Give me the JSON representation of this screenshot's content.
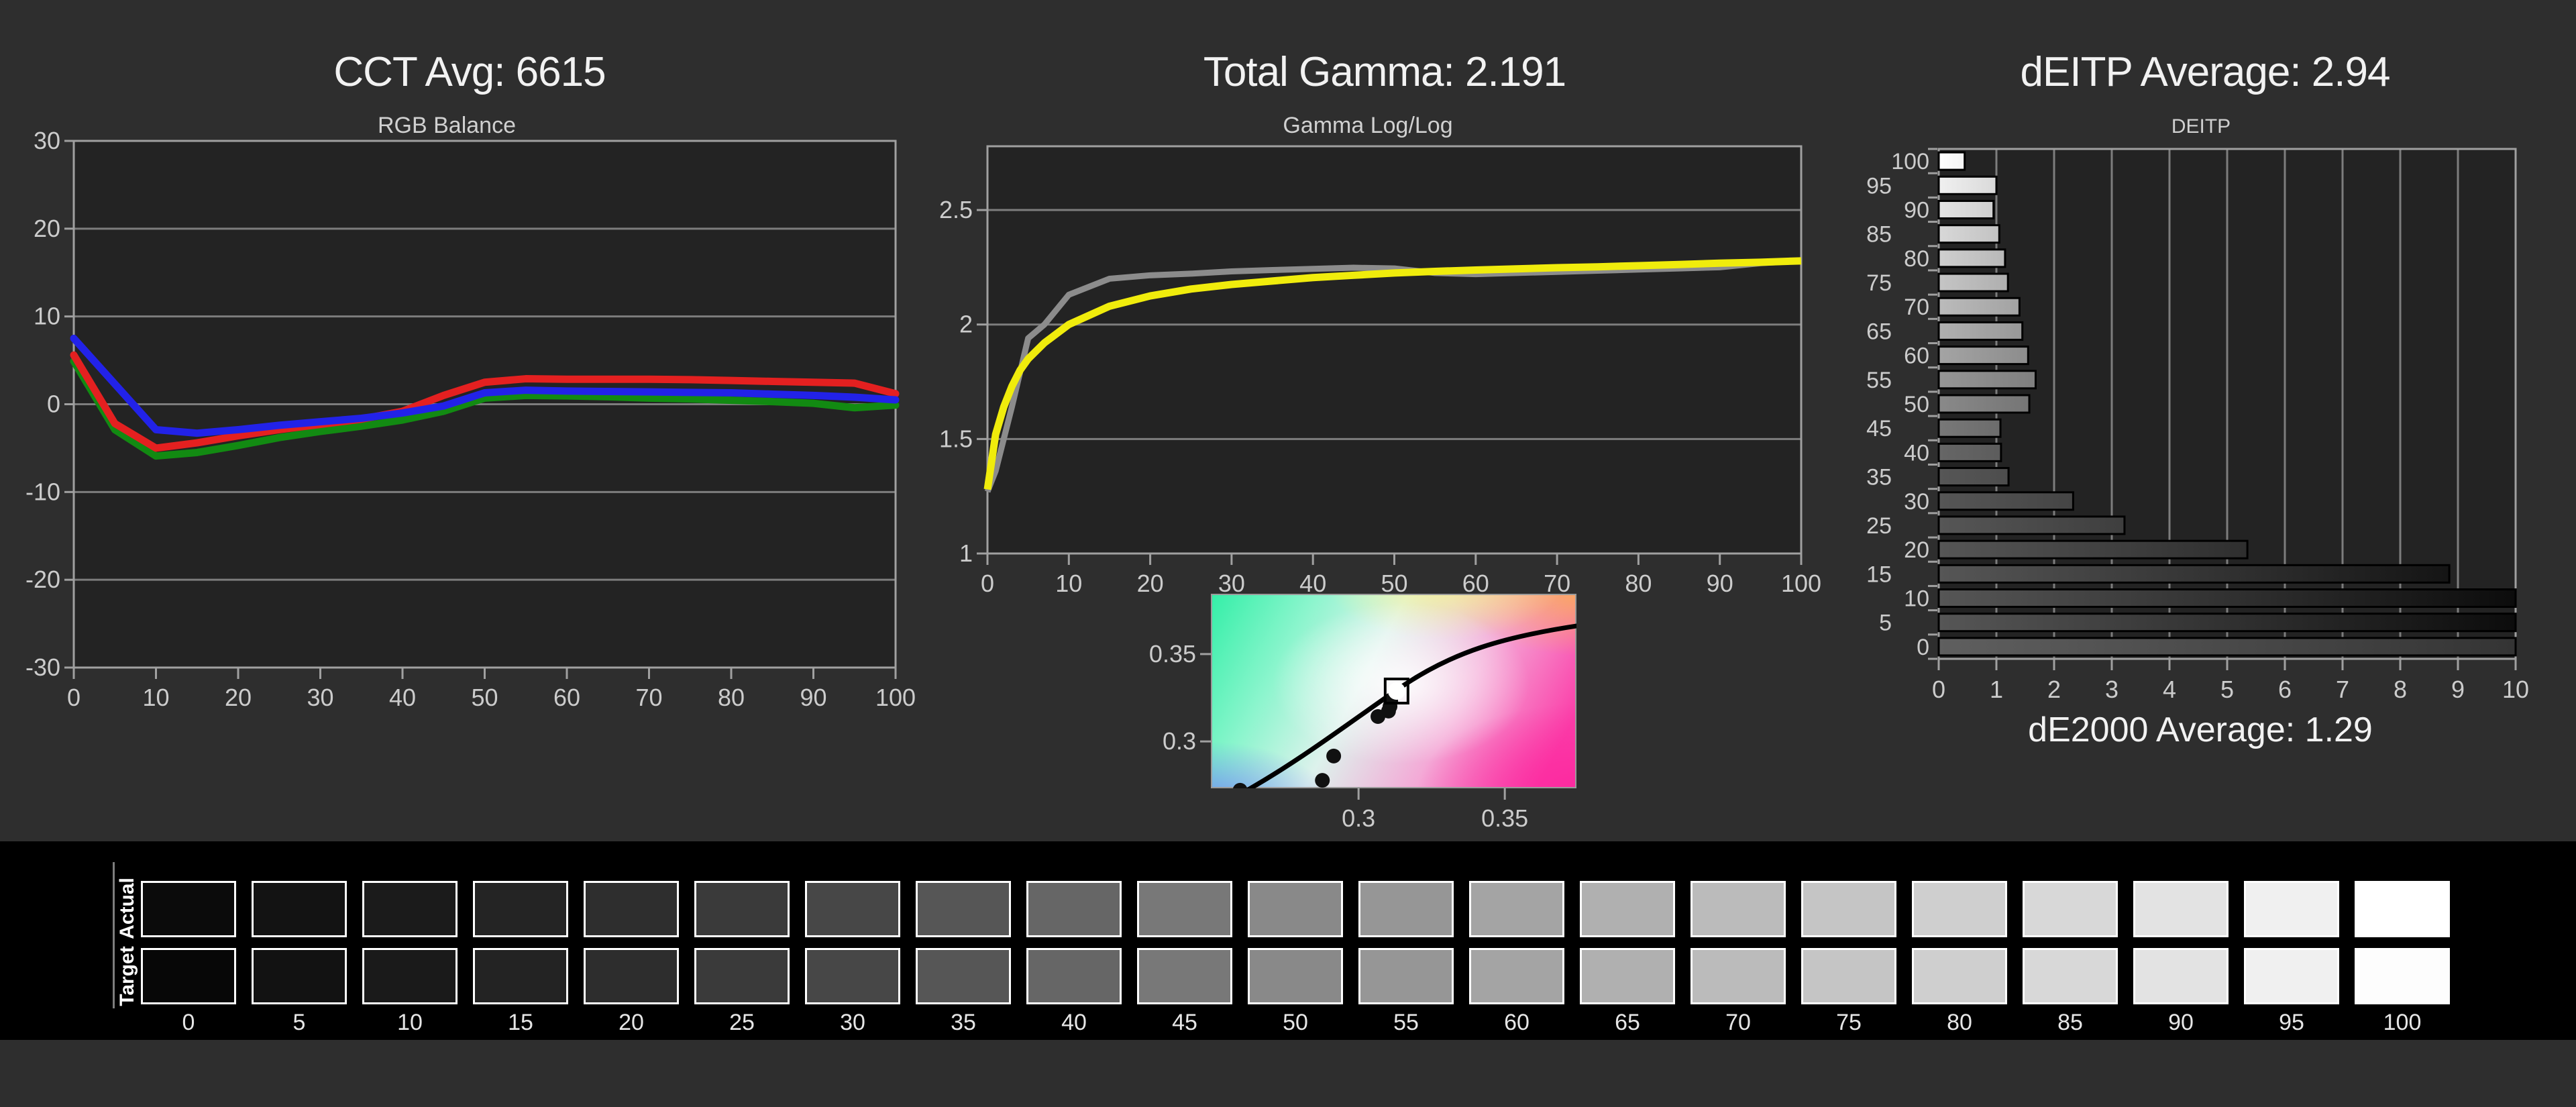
{
  "colors": {
    "page_bg": "#2e2e2e",
    "plot_bg": "#232323",
    "grid": "#7d7d7d",
    "border": "#a0a0a0",
    "tick_text": "#cccccc",
    "title_text": "#f2f2f2",
    "strip_bg": "#000000",
    "red": "#e42020",
    "green": "#128a12",
    "blue": "#2222e8",
    "yellow": "#f0ec0c",
    "gray_line": "#8c8c8c"
  },
  "chart_data": [
    {
      "id": "rgb_balance",
      "type": "line",
      "title": "CCT Avg: 6615",
      "subtitle": "RGB Balance",
      "xlim": [
        0,
        100
      ],
      "ylim": [
        -30,
        30
      ],
      "grid": "horizontal",
      "legend_position": "none",
      "xticks": [
        0,
        10,
        20,
        30,
        40,
        50,
        60,
        70,
        80,
        90,
        100
      ],
      "yticks": [
        30,
        20,
        10,
        0,
        -10,
        -20,
        -30
      ],
      "x": [
        0,
        5,
        10,
        15,
        20,
        25,
        30,
        35,
        40,
        45,
        50,
        55,
        60,
        65,
        70,
        75,
        80,
        85,
        90,
        95,
        100
      ],
      "series": [
        {
          "name": "red",
          "color": "#e42020",
          "values": [
            5.6,
            -2.2,
            -5.0,
            -4.4,
            -3.6,
            -2.9,
            -2.3,
            -1.7,
            -0.8,
            1.0,
            2.5,
            2.9,
            2.85,
            2.85,
            2.85,
            2.8,
            2.7,
            2.6,
            2.5,
            2.4,
            1.2
          ]
        },
        {
          "name": "green",
          "color": "#128a12",
          "values": [
            4.9,
            -2.9,
            -5.9,
            -5.5,
            -4.7,
            -3.8,
            -3.1,
            -2.5,
            -1.8,
            -0.8,
            0.7,
            1.0,
            0.95,
            0.85,
            0.7,
            0.6,
            0.45,
            0.3,
            0.1,
            -0.4,
            -0.1
          ]
        },
        {
          "name": "blue",
          "color": "#2222e8",
          "values": [
            7.5,
            2.3,
            -2.9,
            -3.3,
            -2.9,
            -2.4,
            -2.0,
            -1.6,
            -1.0,
            -0.2,
            1.3,
            1.6,
            1.5,
            1.45,
            1.4,
            1.35,
            1.3,
            1.15,
            1.0,
            0.8,
            0.5
          ]
        }
      ]
    },
    {
      "id": "gamma_loglog",
      "type": "line",
      "title": "Total Gamma: 2.191",
      "subtitle": "Gamma Log/Log",
      "xlim": [
        0,
        100
      ],
      "ylim": [
        1,
        2.78
      ],
      "grid": "horizontal",
      "xticks": [
        0,
        10,
        20,
        30,
        40,
        50,
        60,
        70,
        80,
        90,
        100
      ],
      "yticks": [
        2.5,
        2,
        1.5,
        1
      ],
      "x": [
        0,
        1,
        2,
        3,
        4,
        5,
        7,
        10,
        15,
        20,
        25,
        30,
        35,
        40,
        45,
        50,
        55,
        60,
        65,
        70,
        75,
        80,
        85,
        90,
        95,
        100
      ],
      "series": [
        {
          "name": "measured",
          "color": "#8c8c8c",
          "values": [
            1.27,
            1.36,
            1.5,
            1.64,
            1.79,
            1.94,
            2.0,
            2.13,
            2.2,
            2.215,
            2.222,
            2.232,
            2.238,
            2.243,
            2.248,
            2.245,
            2.225,
            2.22,
            2.225,
            2.23,
            2.235,
            2.24,
            2.245,
            2.25,
            2.268,
            2.278
          ]
        },
        {
          "name": "target",
          "color": "#f0ec0c",
          "values": [
            1.28,
            1.52,
            1.64,
            1.73,
            1.8,
            1.85,
            1.92,
            2.0,
            2.08,
            2.125,
            2.155,
            2.175,
            2.19,
            2.205,
            2.215,
            2.225,
            2.232,
            2.238,
            2.243,
            2.248,
            2.252,
            2.257,
            2.262,
            2.268,
            2.272,
            2.278
          ]
        }
      ]
    },
    {
      "id": "cie_white_point",
      "type": "scatter",
      "xticks": [
        "0.3",
        "0.35"
      ],
      "yticks": [
        "0.35",
        "0.3"
      ],
      "xtick_pct": [
        40.4,
        80.4
      ],
      "ytick_pct": [
        31,
        75.9
      ],
      "points_pct": [
        [
          49.2,
          55.2
        ],
        [
          49.0,
          57.9
        ],
        [
          48.6,
          60.3
        ],
        [
          45.7,
          63.1
        ],
        [
          33.6,
          83.4
        ],
        [
          30.5,
          95.9
        ],
        [
          8,
          101
        ]
      ],
      "marker_pct": [
        50.8,
        50.0
      ],
      "curve_pct": [
        [
          9,
          102
        ],
        [
          25,
          85
        ],
        [
          38,
          66
        ],
        [
          52,
          48
        ],
        [
          66,
          30
        ],
        [
          80,
          22
        ],
        [
          102,
          16
        ]
      ]
    },
    {
      "id": "deitp",
      "type": "bar",
      "title": "dEITP Average: 2.94",
      "subtitle": "DEITP",
      "footer": "dE2000 Average: 1.29",
      "orientation": "horizontal",
      "xlim": [
        0,
        10
      ],
      "xticks": [
        0,
        1,
        2,
        3,
        4,
        5,
        6,
        7,
        8,
        9,
        10
      ],
      "categories": [
        100,
        95,
        90,
        85,
        80,
        75,
        70,
        65,
        60,
        55,
        50,
        45,
        40,
        35,
        30,
        25,
        20,
        15,
        10,
        5,
        0
      ],
      "values": [
        0.45,
        1.0,
        0.95,
        1.05,
        1.15,
        1.2,
        1.4,
        1.45,
        1.55,
        1.68,
        1.57,
        1.07,
        1.08,
        1.21,
        2.33,
        3.22,
        5.35,
        8.85,
        10,
        10,
        10
      ]
    },
    {
      "id": "grayscale_swatches",
      "type": "table",
      "row_labels": [
        "Actual",
        "Target"
      ],
      "levels": [
        0,
        5,
        10,
        15,
        20,
        25,
        30,
        35,
        40,
        45,
        50,
        55,
        60,
        65,
        70,
        75,
        80,
        85,
        90,
        95,
        100
      ],
      "actual_colors": [
        "#0b0b0b",
        "#131313",
        "#1b1b1b",
        "#242424",
        "#2e2e2e",
        "#3a3a3a",
        "#474747",
        "#565656",
        "#666666",
        "#787878",
        "#898989",
        "#969696",
        "#a4a4a4",
        "#b0b0b0",
        "#bbbbbb",
        "#c5c5c5",
        "#cfcfcf",
        "#d8d8d8",
        "#e3e3e3",
        "#f0f0f0",
        "#ffffff"
      ],
      "target_colors": [
        "#070707",
        "#121212",
        "#1a1a1a",
        "#232323",
        "#2d2d2d",
        "#3a3a3a",
        "#474747",
        "#565656",
        "#666666",
        "#787878",
        "#898989",
        "#969696",
        "#a4a4a4",
        "#b0b0b0",
        "#bbbbbb",
        "#c5c5c5",
        "#cfcfcf",
        "#d8d8d8",
        "#e3e3e3",
        "#f0f0f0",
        "#fdfdfd"
      ]
    }
  ]
}
